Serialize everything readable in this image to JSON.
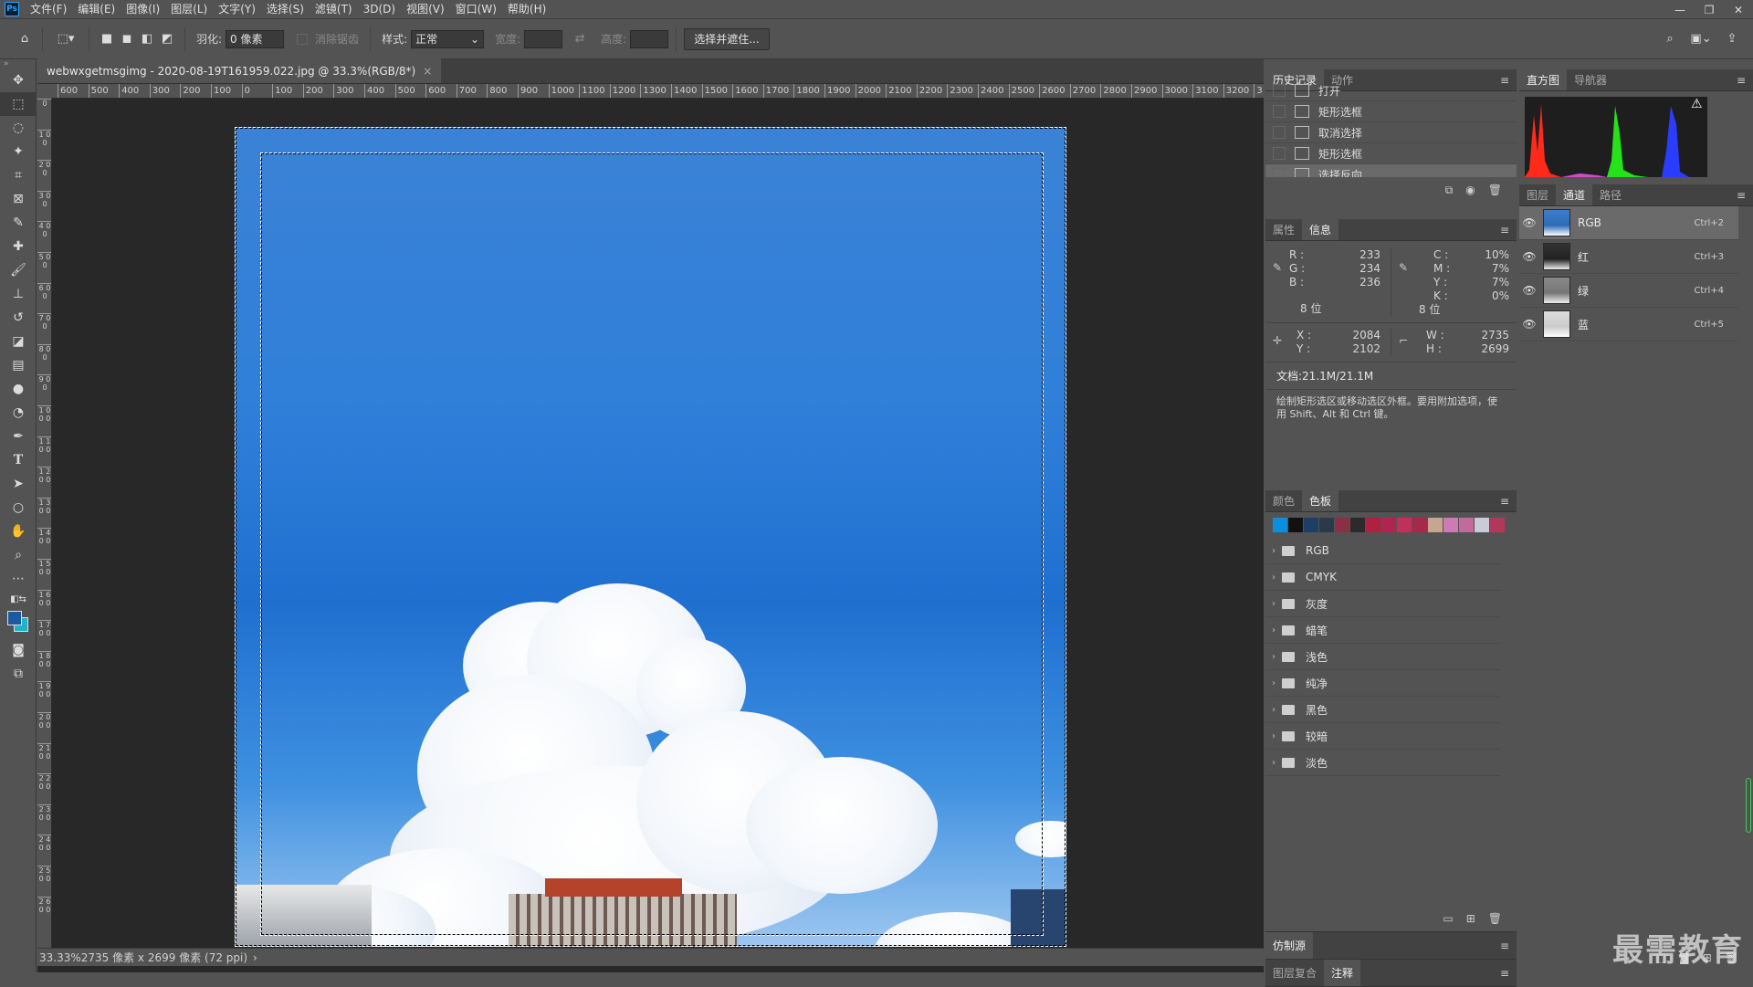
{
  "menubar": {
    "app_icon": "Ps",
    "items": [
      "文件(F)",
      "编辑(E)",
      "图像(I)",
      "图层(L)",
      "文字(Y)",
      "选择(S)",
      "滤镜(T)",
      "3D(D)",
      "视图(V)",
      "窗口(W)",
      "帮助(H)"
    ],
    "window_controls": [
      "—",
      "❐",
      "✕"
    ]
  },
  "options": {
    "feather_label": "羽化:",
    "feather_value": "0 像素",
    "antialias_label": "消除锯齿",
    "style_label": "样式:",
    "style_value": "正常",
    "width_label": "宽度:",
    "height_label": "高度:",
    "select_mask_button": "选择并遮住..."
  },
  "document": {
    "tab_title": "webwxgetmsgimg - 2020-08-19T161959.022.jpg @ 33.3%(RGB/8*)",
    "tab_close": "×",
    "ruler_h": [
      "600",
      "500",
      "400",
      "300",
      "200",
      "100",
      "0",
      "100",
      "200",
      "300",
      "400",
      "500",
      "600",
      "700",
      "800",
      "900",
      "1000",
      "1100",
      "1200",
      "1300",
      "1400",
      "1500",
      "1600",
      "1700",
      "1800",
      "1900",
      "2000",
      "2100",
      "2200",
      "2300",
      "2400",
      "2500",
      "2600",
      "2700",
      "2800",
      "2900",
      "3000",
      "3100",
      "3200",
      "3"
    ],
    "ruler_v": [
      "0",
      "1 0 0",
      "2 0 0",
      "3 0 0",
      "4 0 0",
      "5 0 0",
      "6 0 0",
      "7 0 0",
      "8 0 0",
      "9 0 0",
      "1 0 0 0",
      "1 1 0 0",
      "1 2 0 0",
      "1 3 0 0",
      "1 4 0 0",
      "1 5 0 0",
      "1 6 0 0",
      "1 7 0 0",
      "1 8 0 0",
      "1 9 0 0",
      "2 0 0 0",
      "2 1 0 0",
      "2 2 0 0",
      "2 3 0 0",
      "2 4 0 0",
      "2 5 0 0",
      "2 6 0 0"
    ],
    "status_zoom": "33.33%",
    "status_info": "2735 像素 x 2699 像素 (72 ppi)",
    "status_arrow": "›"
  },
  "history": {
    "tabs": [
      "历史记录",
      "动作"
    ],
    "rows": [
      {
        "label": "打开",
        "active": false
      },
      {
        "label": "矩形选框",
        "active": false
      },
      {
        "label": "取消选择",
        "active": false
      },
      {
        "label": "矩形选框",
        "active": false
      },
      {
        "label": "选择反向",
        "active": true
      }
    ]
  },
  "info": {
    "tabs": [
      "属性",
      "信息"
    ],
    "R": "233",
    "G": "234",
    "B": "236",
    "C": "10%",
    "M": "7%",
    "Y": "7%",
    "K": "0%",
    "bit_left": "8 位",
    "bit_right": "8 位",
    "X": "2084",
    "Y_coord": "2102",
    "W": "2735",
    "H": "2699",
    "doc_size": "文档:21.1M/21.1M",
    "hint": "绘制矩形选区或移动选区外框。要用附加选项，使用 Shift、Alt 和 Ctrl 键。",
    "labels": {
      "R": "R :",
      "G": "G :",
      "B": "B :",
      "C": "C :",
      "M": "M :",
      "Y": "Y :",
      "K": "K :",
      "X": "X :",
      "Yc": "Y :",
      "W": "W :",
      "H": "H :"
    }
  },
  "swatches": {
    "tabs": [
      "颜色",
      "色板"
    ],
    "colors": [
      "#0a8fe0",
      "#111111",
      "#1d3f66",
      "#2a3a4a",
      "#8a2f45",
      "#2b2b2b",
      "#b0203f",
      "#b02550",
      "#c0305a",
      "#a52a4a",
      "#c8a590",
      "#d07ab5",
      "#c26a9a",
      "#c8ccd6",
      "#b0385a"
    ],
    "groups": [
      "RGB",
      "CMYK",
      "灰度",
      "蜡笔",
      "浅色",
      "纯净",
      "黑色",
      "较暗",
      "淡色"
    ]
  },
  "histogram": {
    "tabs": [
      "直方图",
      "导航器"
    ],
    "warning": "⚠"
  },
  "channels": {
    "tabs": [
      "图层",
      "通道",
      "路径"
    ],
    "rows": [
      {
        "name": "RGB",
        "key": "Ctrl+2",
        "active": true
      },
      {
        "name": "红",
        "key": "Ctrl+3",
        "active": false
      },
      {
        "name": "绿",
        "key": "Ctrl+4",
        "active": false
      },
      {
        "name": "蓝",
        "key": "Ctrl+5",
        "active": false
      }
    ]
  },
  "bottom_panels": {
    "clone_source": "仿制源",
    "layer_comps": "图层复合",
    "notes": "注释"
  },
  "watermark": "最需教育"
}
